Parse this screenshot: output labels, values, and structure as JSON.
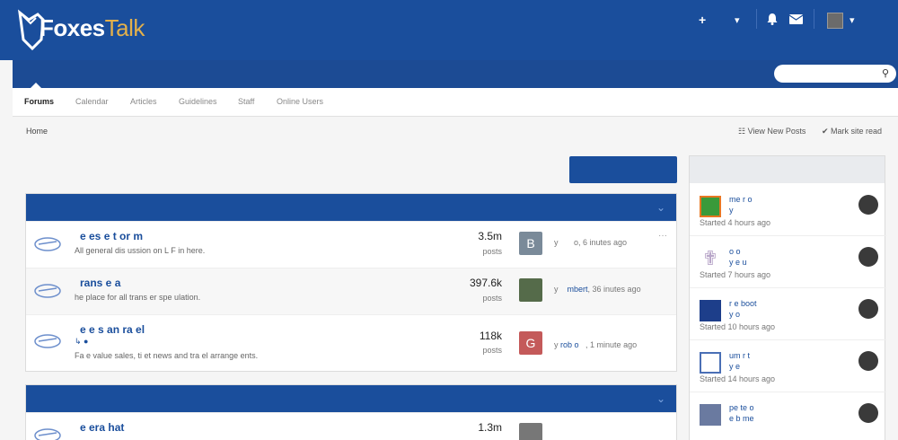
{
  "brand": {
    "name": "Foxes",
    "suffix": "Talk"
  },
  "header": {
    "create_icon": "+",
    "dropdown_icon": "▾",
    "bell_icon": "bell-icon",
    "mail_icon": "mail-icon"
  },
  "search": {
    "placeholder": ""
  },
  "tabs": [
    {
      "label": "Forums"
    },
    {
      "label": "Calendar"
    },
    {
      "label": "Articles"
    },
    {
      "label": "Guidelines"
    },
    {
      "label": "Staff"
    },
    {
      "label": "Online Users"
    }
  ],
  "breadcrumb": "Home",
  "actions": {
    "view_new": "View New Posts",
    "mark_read": "Mark site read"
  },
  "forums": [
    {
      "title": "e  es e     t    or  m",
      "desc": "All general dis  ussion on L  F    in here.",
      "count": "3.5m",
      "count_label": "posts",
      "avatar_letter": "B",
      "lp_by": "y",
      "lp_name": "",
      "lp_time": "o, 6     inutes ago"
    },
    {
      "title": "rans  e   a",
      "desc": "he place for all trans  er spe  ulation.",
      "count": "397.6k",
      "count_label": "posts",
      "avatar_letter": "",
      "lp_by": "y",
      "lp_name": "mbert",
      "lp_time": ", 36     inutes ago"
    },
    {
      "title": "e    e s an    ra  el",
      "desc": "Fa  e value sales, ti     et news and tra  el arrange     ents.",
      "count": "118k",
      "count_label": "posts",
      "avatar_letter": "G",
      "lp_by": "y",
      "lp_name": "rob    o",
      "lp_time": ", 1 minute ago"
    },
    {
      "title": "e  era    hat",
      "desc": "",
      "count": "1.3m",
      "count_label": "posts",
      "avatar_letter": "",
      "lp_by": "",
      "lp_name": "",
      "lp_time": ""
    }
  ],
  "topics": [
    {
      "title": "me      r  o",
      "by": "y",
      "date": "Started 4 hours ago"
    },
    {
      "title": "o        o",
      "by": "y    e     u",
      "date": "Started 7 hours ago"
    },
    {
      "title": "r               e  boot",
      "by": "y     o",
      "date": "Started 10 hours ago"
    },
    {
      "title": "um     r    t",
      "by": "y       e",
      "date": "Started 14 hours ago"
    },
    {
      "title": "pe  te     o",
      "by": "e  b     me",
      "date": ""
    }
  ],
  "colors": {
    "brand_blue": "#1a4e9c",
    "gold": "#e3b04b"
  }
}
